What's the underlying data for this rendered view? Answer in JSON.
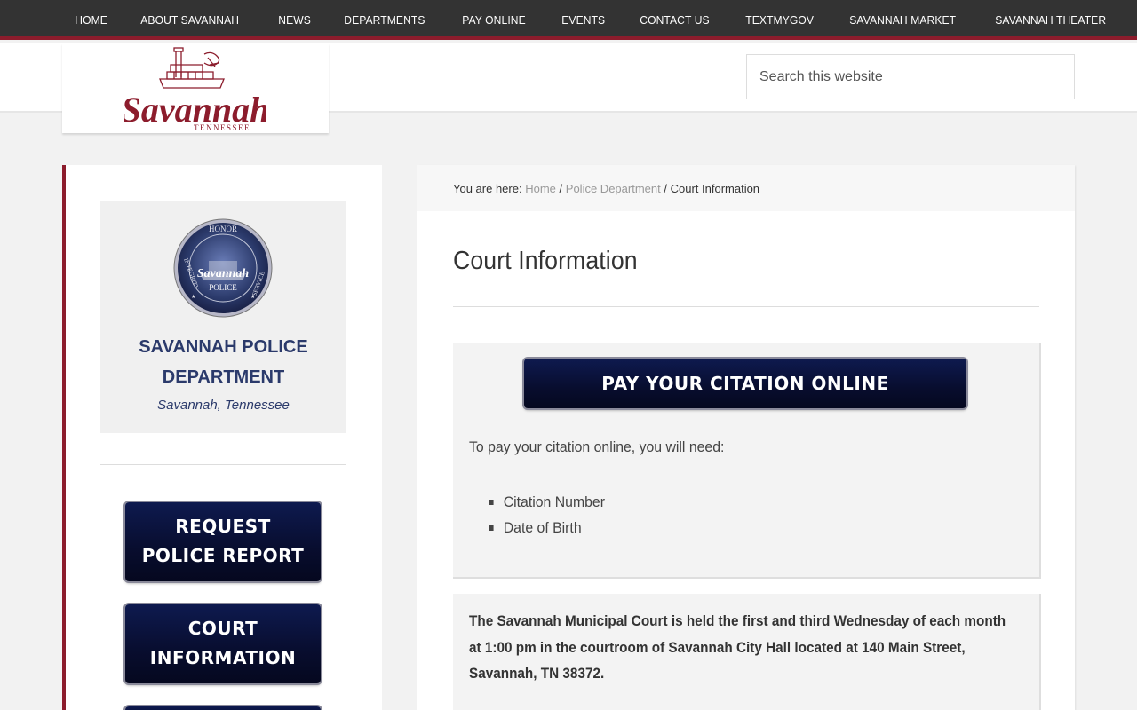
{
  "topnav": {
    "items": [
      {
        "label": "HOME"
      },
      {
        "label": "ABOUT SAVANNAH"
      },
      {
        "label": "NEWS"
      },
      {
        "label": "DEPARTMENTS"
      },
      {
        "label": "PAY ONLINE"
      },
      {
        "label": "EVENTS"
      },
      {
        "label": "CONTACT US"
      },
      {
        "label": "TEXTMYGOV"
      },
      {
        "label": "SAVANNAH MARKET"
      },
      {
        "label": "SAVANNAH THEATER"
      }
    ]
  },
  "logo": {
    "name": "Savannah",
    "sub": "TENNESSEE",
    "accent": "#8c1c2c"
  },
  "search": {
    "placeholder": "Search this website"
  },
  "sidebar": {
    "badge": {
      "top": "HONOR",
      "center": "Savannah",
      "bottom": "POLICE",
      "left": "INTEGRITY",
      "right": "SERVICE"
    },
    "title": "SAVANNAH POLICE DEPARTMENT",
    "title_line1": "SAVANNAH POLICE",
    "title_line2": "DEPARTMENT",
    "subtitle": "Savannah, Tennessee",
    "buttons": [
      {
        "line1": "REQUEST",
        "line2": "POLICE REPORT"
      },
      {
        "line1": "COURT",
        "line2": "INFORMATION"
      }
    ]
  },
  "breadcrumb": {
    "prefix": "You are here:",
    "items": [
      "Home",
      "Police Department",
      "Court Information"
    ],
    "separator": "/"
  },
  "page": {
    "title": "Court Information",
    "pay_button": "PAY YOUR CITATION ONLINE",
    "need_text": "To pay your citation online, you will need:",
    "requirements": [
      "Citation Number",
      "Date of Birth"
    ],
    "court_text": "The Savannah Municipal Court is held the first and third Wednesday of each month at 1:00 pm in the courtroom of Savannah City Hall located at 140 Main Street, Savannah, TN 38372."
  },
  "colors": {
    "nav_bg": "#333333",
    "accent": "#8c1c2c",
    "navy": "#0e1a4f",
    "sidebar_title": "#2b3a6b"
  }
}
